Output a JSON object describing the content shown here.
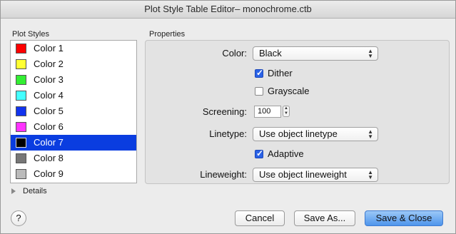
{
  "window": {
    "title": "Plot Style Table Editor– monochrome.ctb"
  },
  "plot_styles": {
    "label": "Plot Styles",
    "items": [
      {
        "label": "Color 1",
        "color": "#ff0000"
      },
      {
        "label": "Color 2",
        "color": "#ffff33"
      },
      {
        "label": "Color 3",
        "color": "#33ee33"
      },
      {
        "label": "Color 4",
        "color": "#44ffff"
      },
      {
        "label": "Color 5",
        "color": "#1133ee"
      },
      {
        "label": "Color 6",
        "color": "#ff33ff"
      },
      {
        "label": "Color 7",
        "color": "#000000",
        "selected": true
      },
      {
        "label": "Color 8",
        "color": "#777777"
      },
      {
        "label": "Color 9",
        "color": "#bbbbbb"
      }
    ]
  },
  "properties": {
    "label": "Properties",
    "color": {
      "label": "Color:",
      "value": "Black"
    },
    "dither": {
      "label": "Dither",
      "checked": true
    },
    "grayscale": {
      "label": "Grayscale",
      "checked": false
    },
    "screening": {
      "label": "Screening:",
      "value": "100"
    },
    "linetype": {
      "label": "Linetype:",
      "value": "Use object linetype"
    },
    "adaptive": {
      "label": "Adaptive",
      "checked": true
    },
    "lineweight": {
      "label": "Lineweight:",
      "value": "Use object lineweight"
    }
  },
  "details": {
    "label": "Details"
  },
  "footer": {
    "help": "?",
    "cancel": "Cancel",
    "save_as": "Save As...",
    "save_close": "Save & Close"
  }
}
